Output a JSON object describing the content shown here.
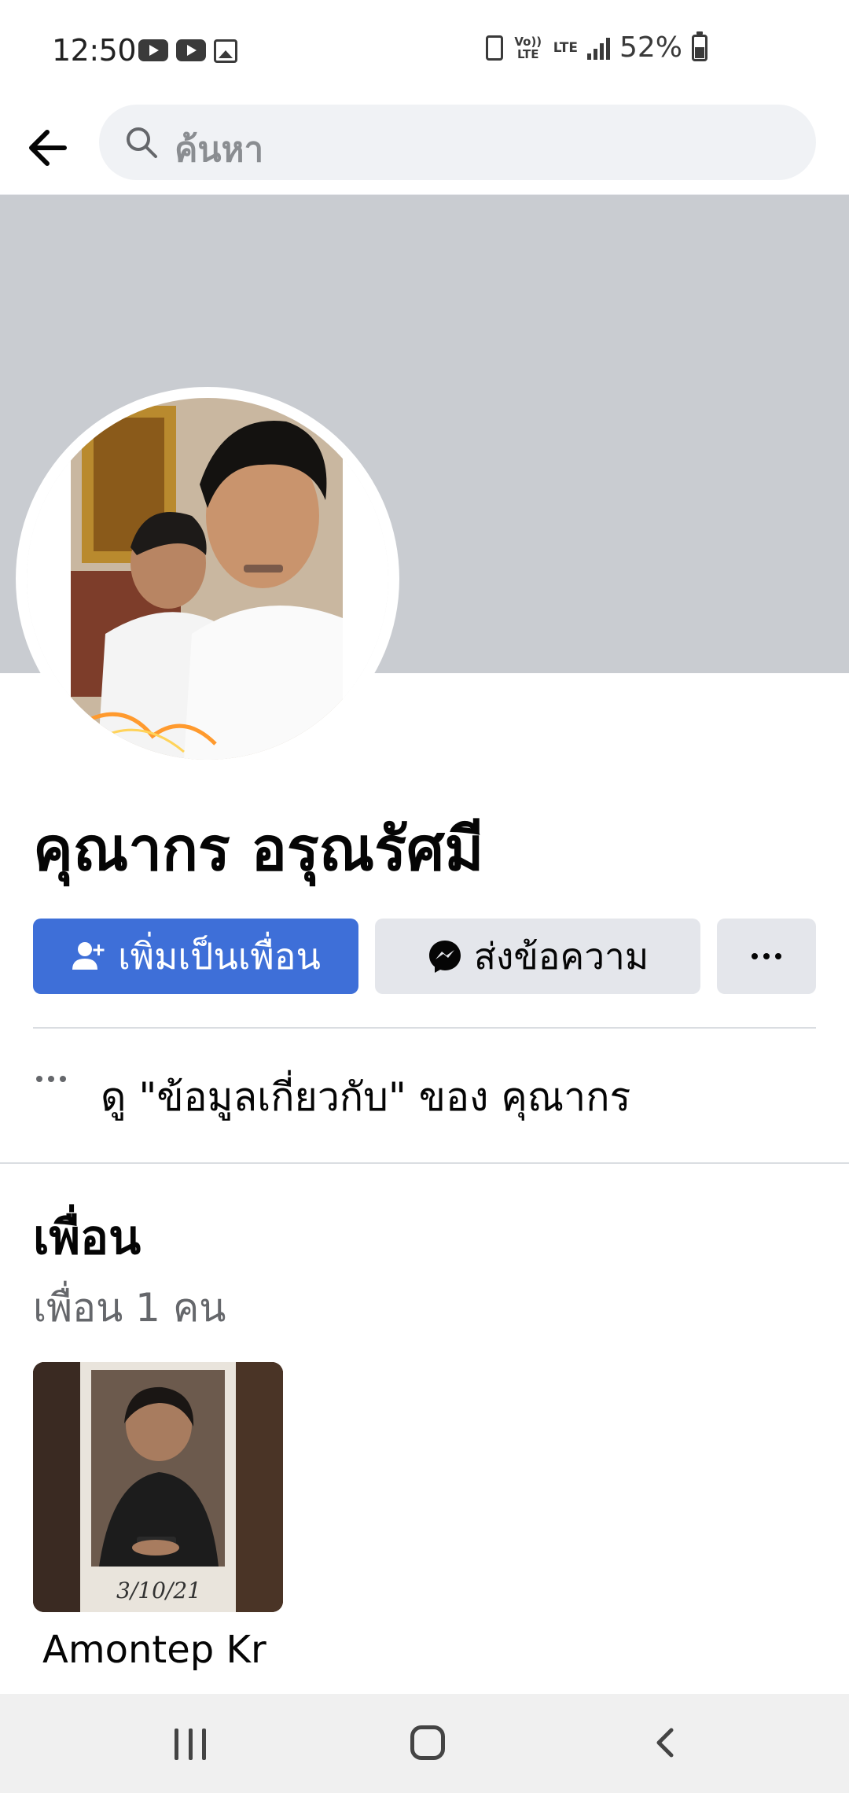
{
  "status_bar": {
    "time": "12:50",
    "left_icons": [
      "youtube-icon",
      "youtube-icon",
      "gallery-icon"
    ],
    "network": [
      "Vo)) LTE",
      "LTE"
    ],
    "battery": "52%"
  },
  "header": {
    "search_placeholder": "ค้นหา"
  },
  "profile": {
    "name": "คุณากร อรุณรัศมี",
    "add_friend_label": "เพิ่มเป็นเพื่อน",
    "message_label": "ส่งข้อความ",
    "about_link": "ดู \"ข้อมูลเกี่ยวกับ\" ของ คุณากร"
  },
  "friends": {
    "title": "เพื่อน",
    "count_label": "เพื่อน 1 คน",
    "items": [
      {
        "name": "Amontep Kr",
        "photo_caption": "3/10/21"
      }
    ]
  },
  "colors": {
    "primary": "#3e6fd8",
    "button_secondary": "#e4e6eb",
    "cover": "#c9ccd1",
    "muted_text": "#65676b"
  }
}
